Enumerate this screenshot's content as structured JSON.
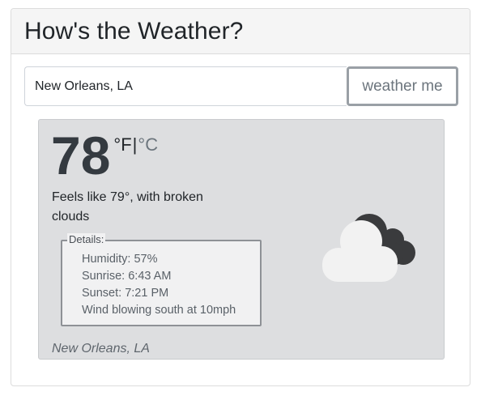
{
  "header": {
    "title": "How's the Weather?"
  },
  "search": {
    "value": "New Orleans, LA",
    "button_label": "weather me"
  },
  "weather": {
    "temperature": "78",
    "unit_f": "°F",
    "unit_separator": "|",
    "unit_c": "°C",
    "feels_like": "Feels like 79°, with broken clouds",
    "details": {
      "legend": "Details:",
      "humidity": "Humidity: 57%",
      "sunrise": "Sunrise: 6:43 AM",
      "sunset": "Sunset: 7:21 PM",
      "wind": "Wind blowing south at 10mph"
    },
    "icon": "broken-clouds-icon",
    "location": "New Orleans, LA"
  },
  "colors": {
    "panel_bg": "#dddee0",
    "dark_cloud": "#3a3b3d",
    "light_cloud": "#f2f2f2"
  }
}
